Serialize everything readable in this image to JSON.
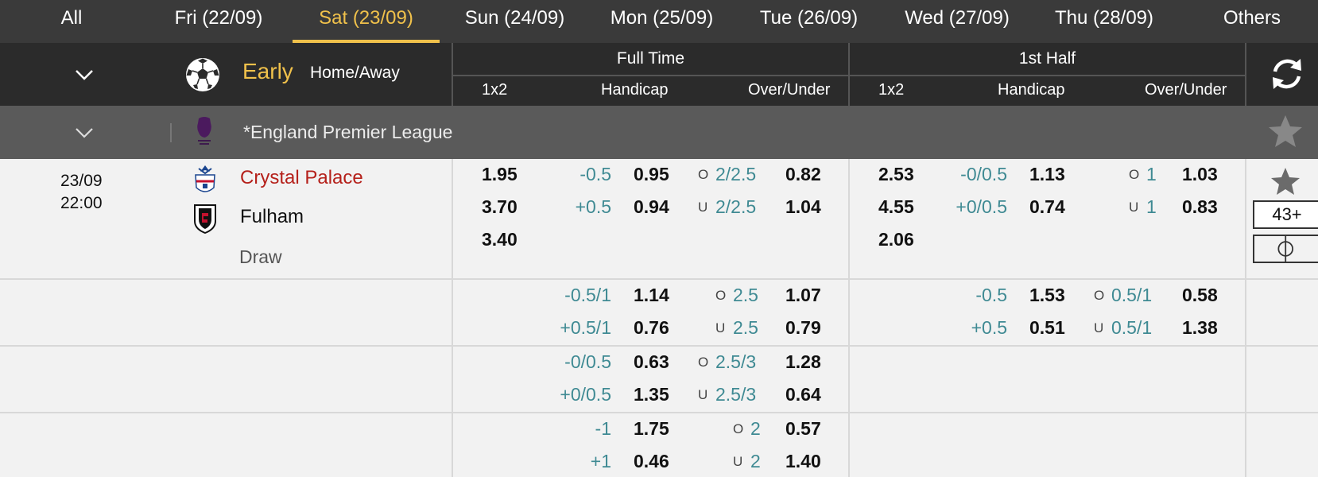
{
  "tabs": [
    {
      "label": "All"
    },
    {
      "label": "Fri (22/09)"
    },
    {
      "label": "Sat (23/09)"
    },
    {
      "label": "Sun (24/09)"
    },
    {
      "label": "Mon (25/09)"
    },
    {
      "label": "Tue (26/09)"
    },
    {
      "label": "Wed (27/09)"
    },
    {
      "label": "Thu (28/09)"
    },
    {
      "label": "Others"
    }
  ],
  "active_tab": "Sat (23/09)",
  "header": {
    "early_label": "Early",
    "home_away_label": "Home/Away",
    "full_time": "Full Time",
    "first_half": "1st Half",
    "col_1x2": "1x2",
    "col_handicap": "Handicap",
    "col_over_under": "Over/Under"
  },
  "league": {
    "name": "*England Premier League"
  },
  "match": {
    "date": "23/09",
    "time": "22:00",
    "home": "Crystal Palace",
    "away": "Fulham",
    "draw_label": "Draw",
    "more_markets": "43+",
    "ft": {
      "x12": [
        "1.95",
        "3.70",
        "3.40"
      ],
      "hdp_lines": [
        {
          "home_line": "-0.5",
          "home_odds": "0.95",
          "away_line": "+0.5",
          "away_odds": "0.94"
        },
        {
          "home_line": "-0.5/1",
          "home_odds": "1.14",
          "away_line": "+0.5/1",
          "away_odds": "0.76"
        },
        {
          "home_line": "-0/0.5",
          "home_odds": "0.63",
          "away_line": "+0/0.5",
          "away_odds": "1.35"
        },
        {
          "home_line": "-1",
          "home_odds": "1.75",
          "away_line": "+1",
          "away_odds": "0.46"
        }
      ],
      "ou_lines": [
        {
          "line": "2/2.5",
          "over": "0.82",
          "under": "1.04"
        },
        {
          "line": "2.5",
          "over": "1.07",
          "under": "0.79"
        },
        {
          "line": "2.5/3",
          "over": "1.28",
          "under": "0.64"
        },
        {
          "line": "2",
          "over": "0.57",
          "under": "1.40"
        }
      ]
    },
    "fh": {
      "x12": [
        "2.53",
        "4.55",
        "2.06"
      ],
      "hdp_lines": [
        {
          "home_line": "-0/0.5",
          "home_odds": "1.13",
          "away_line": "+0/0.5",
          "away_odds": "0.74"
        },
        {
          "home_line": "-0.5",
          "home_odds": "1.53",
          "away_line": "+0.5",
          "away_odds": "0.51"
        }
      ],
      "ou_lines": [
        {
          "line": "1",
          "over": "1.03",
          "under": "0.83"
        },
        {
          "line": "0.5/1",
          "over": "0.58",
          "under": "1.38"
        }
      ]
    }
  },
  "labels": {
    "over": "O",
    "under": "U"
  },
  "colors": {
    "accent": "#f0c14b",
    "home_team": "#b5211b",
    "line_value": "#3f8a93"
  }
}
